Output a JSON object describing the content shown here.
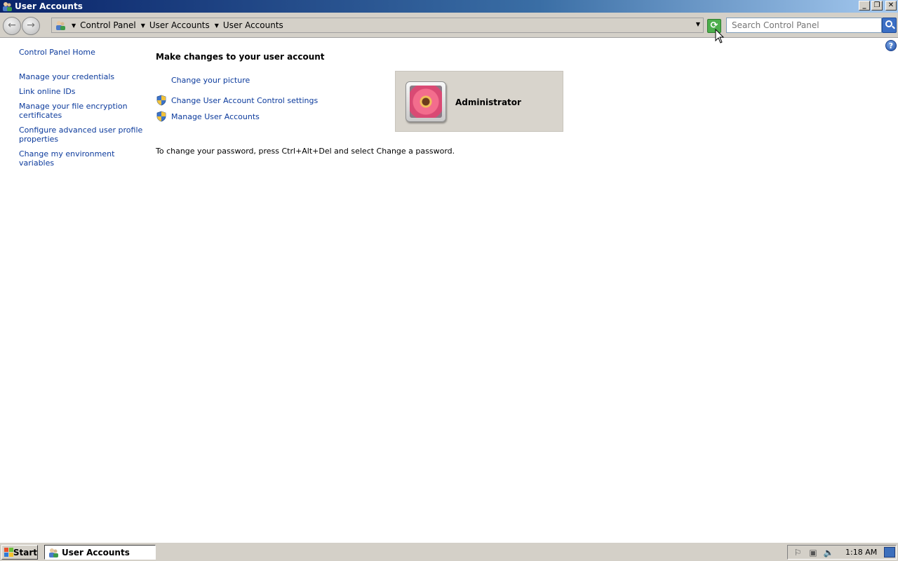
{
  "window": {
    "title": "User Accounts",
    "buttons": {
      "minimize": "_",
      "restore": "❐",
      "close": "✕"
    }
  },
  "address_bar": {
    "breadcrumbs": [
      "Control Panel",
      "User Accounts",
      "User Accounts"
    ],
    "search_placeholder": "Search Control Panel"
  },
  "left_pane": {
    "home": "Control Panel Home",
    "links": [
      "Manage your credentials",
      "Link online IDs",
      "Manage your file encryption certificates",
      "Configure advanced user profile properties",
      "Change my environment variables"
    ]
  },
  "main": {
    "title": "Make changes to your user account",
    "tasks": {
      "change_picture": "Change your picture",
      "change_uac": "Change User Account Control settings",
      "manage_accounts": "Manage User Accounts"
    },
    "password_note": "To change your password, press Ctrl+Alt+Del and select Change a password.",
    "user": {
      "name": "Administrator"
    }
  },
  "taskbar": {
    "start_label": "Start",
    "active_window": "User Accounts",
    "clock": "1:18 AM"
  },
  "icons": {
    "nav": "arrow-icons",
    "refresh": "refresh-icon",
    "search": "magnifier-icon",
    "help": "help-icon",
    "shield": "uac-shield-icon"
  }
}
